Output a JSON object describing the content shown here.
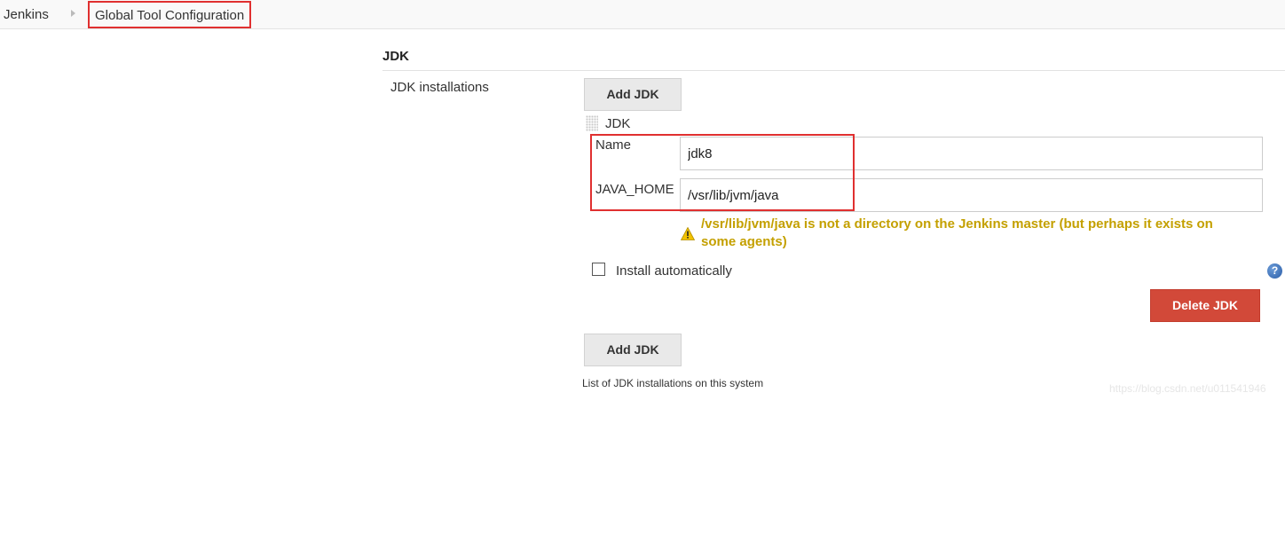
{
  "breadcrumb": {
    "home": "Jenkins",
    "current": "Global Tool Configuration"
  },
  "section": {
    "title": "JDK",
    "row_label": "JDK installations",
    "add_button": "Add JDK",
    "jdk_header": "JDK",
    "fields": {
      "name_label": "Name",
      "name_value": "jdk8",
      "java_home_label": "JAVA_HOME",
      "java_home_value": "/vsr/lib/jvm/java"
    },
    "warning": "/vsr/lib/jvm/java is not a directory on the Jenkins master (but perhaps it exists on some agents)",
    "install_automatically_label": "Install automatically",
    "install_automatically_checked": false,
    "help_icon_glyph": "?",
    "delete_button": "Delete JDK",
    "add_button_bottom": "Add JDK",
    "description": "List of JDK installations on this system"
  },
  "watermark": "https://blog.csdn.net/u011541946",
  "colors": {
    "warning": "#c4a000",
    "delete_button": "#d24939",
    "highlight": "#e03030"
  }
}
